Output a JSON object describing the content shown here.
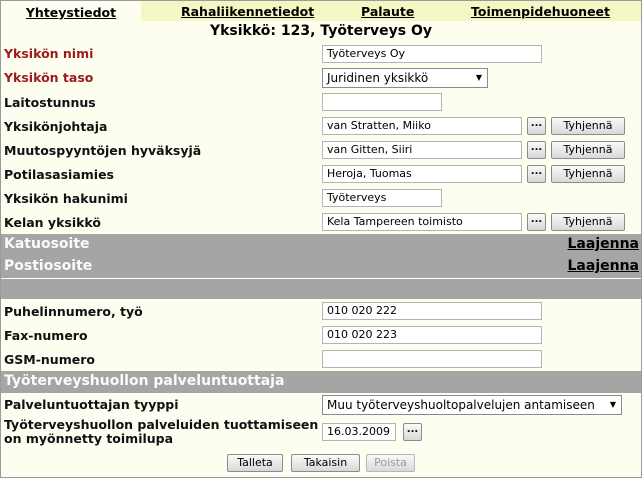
{
  "tabs": [
    {
      "label": "Yhteystiedot",
      "active": true
    },
    {
      "label": "Rahaliikennetiedot",
      "active": false
    },
    {
      "label": "Palaute",
      "active": false
    },
    {
      "label": "Toimenpidehuoneet",
      "active": false
    }
  ],
  "unit_title": "Yksikkö: 123, Työterveys Oy",
  "fields": {
    "yksikon_nimi": {
      "label": "Yksikön nimi",
      "value": "Työterveys Oy"
    },
    "yksikon_taso": {
      "label": "Yksikön taso",
      "value": "Juridinen yksikkö"
    },
    "laitostunnus": {
      "label": "Laitostunnus",
      "value": ""
    },
    "yksikonjohtaja": {
      "label": "Yksikönjohtaja",
      "value": "van Stratten, Miiko"
    },
    "muutospyyntojen_hyvaksyja": {
      "label": "Muutospyyntöjen hyväksyjä",
      "value": "van Gitten, Siiri"
    },
    "potilasasiamies": {
      "label": "Potilasasiamies",
      "value": "Heroja, Tuomas"
    },
    "yksikon_hakunimi": {
      "label": "Yksikön hakunimi",
      "value": "Työterveys"
    },
    "kelan_yksikko": {
      "label": "Kelan yksikkö",
      "value": "Kela Tampereen toimisto"
    },
    "puhelinnumero": {
      "label": "Puhelinnumero, työ",
      "value": "010 020 222"
    },
    "fax": {
      "label": "Fax-numero",
      "value": "010 020 223"
    },
    "gsm": {
      "label": "GSM-numero",
      "value": ""
    },
    "palveluntuottajan_tyyppi": {
      "label": "Palveluntuottajan tyyppi",
      "value": "Muu työterveyshuoltopalvelujen antamiseen"
    },
    "toimilupa": {
      "label": "Työterveyshuollon palveluiden tuottamiseen on myönnetty toimilupa",
      "value": "16.03.2009"
    }
  },
  "buttons": {
    "dots": "...",
    "clear": "Tyhjennä",
    "save": "Talleta",
    "back": "Takaisin",
    "delete": "Poista"
  },
  "sections": {
    "katuosoite": {
      "title": "Katuosoite",
      "link": "Laajenna"
    },
    "postiosoite": {
      "title": "Postiosoite",
      "link": "Laajenna"
    },
    "palveluntuottaja": {
      "title": "Työterveyshuollon palveluntuottaja"
    }
  },
  "icons": {
    "dropdown": "chevron-down-icon"
  },
  "colors": {
    "required_label": "#9b1b1b",
    "section_bar": "#a5a5a5",
    "tab_bar": "#f4f6c4",
    "background": "#fdfef0"
  }
}
